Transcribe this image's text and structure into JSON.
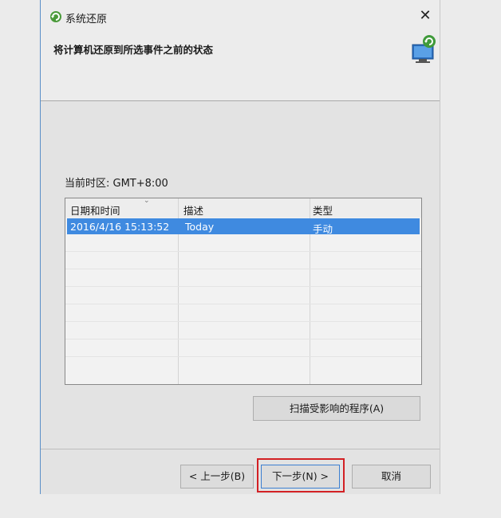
{
  "window": {
    "title": "系统还原",
    "heading": "将计算机还原到所选事件之前的状态",
    "close_symbol": "✕"
  },
  "timezone_label": "当前时区: GMT+8:00",
  "restore_list": {
    "columns": [
      "日期和时间",
      "描述",
      "类型"
    ],
    "sort_indicator": "⌄",
    "rows": [
      {
        "date_time": "2016/4/16 15:13:52",
        "description": "Today",
        "type": "手动"
      }
    ]
  },
  "buttons": {
    "scan": "扫描受影响的程序(A)",
    "back": "< 上一步(B)",
    "next": "下一步(N) >",
    "cancel": "取消"
  },
  "colors": {
    "selection": "#3f8ae0",
    "highlight_box": "#d32024",
    "focus_border": "#3c7fd1"
  }
}
